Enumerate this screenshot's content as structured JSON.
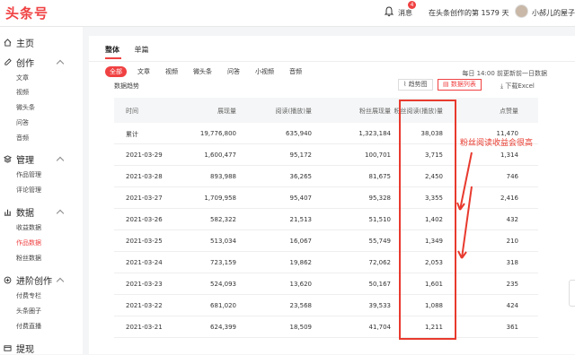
{
  "app": {
    "logo_text": "头条号",
    "messages_label": "消息",
    "messages_badge": "4",
    "days_text": "在头条创作的第 1579 天",
    "username": "小郝儿的屋子",
    "brand_color": "#f04142"
  },
  "sidebar": {
    "groups": [
      {
        "label": "主页",
        "icon": "home-icon",
        "items": []
      },
      {
        "label": "创作",
        "icon": "edit-icon",
        "items": [
          "文章",
          "视频",
          "微头条",
          "问答",
          "音频"
        ]
      },
      {
        "label": "管理",
        "icon": "layers-icon",
        "items": [
          "作品管理",
          "评论管理"
        ]
      },
      {
        "label": "数据",
        "icon": "chart-icon",
        "items": [
          "收益数据",
          "作品数据",
          "粉丝数据"
        ],
        "active_item": "作品数据"
      },
      {
        "label": "进阶创作",
        "icon": "advanced-icon",
        "items": [
          "付费专栏",
          "头条圈子",
          "付费直播"
        ]
      },
      {
        "label": "提现",
        "icon": "withdraw-icon",
        "items": []
      }
    ]
  },
  "panel": {
    "tabs": [
      "整体",
      "单篇"
    ],
    "active_tab": "整体",
    "chips": [
      "全部",
      "文章",
      "视频",
      "微头条",
      "问答",
      "小视频",
      "音频"
    ],
    "active_chip": "全部",
    "update_note": "每日 14:00 前更新前一日数据",
    "section_title": "数据趋势",
    "trend_button": "趋势图",
    "list_button": "数据列表",
    "excel_button": "下载Excel"
  },
  "table": {
    "headers": [
      "时间",
      "展现量",
      "阅读(播放)量",
      "粉丝展现量",
      "粉丝阅读(播放)量",
      "点赞量"
    ],
    "rows": [
      [
        "累计",
        "19,776,800",
        "635,940",
        "1,323,184",
        "38,038",
        "11,470"
      ],
      [
        "2021-03-29",
        "1,600,477",
        "95,172",
        "100,701",
        "3,715",
        "1,314"
      ],
      [
        "2021-03-28",
        "893,988",
        "36,265",
        "81,675",
        "2,450",
        "746"
      ],
      [
        "2021-03-27",
        "1,709,958",
        "95,407",
        "95,328",
        "3,355",
        "2,416"
      ],
      [
        "2021-03-26",
        "582,322",
        "21,513",
        "51,510",
        "1,402",
        "432"
      ],
      [
        "2021-03-25",
        "513,034",
        "16,067",
        "55,749",
        "1,349",
        "210"
      ],
      [
        "2021-03-24",
        "723,159",
        "19,862",
        "72,062",
        "2,053",
        "318"
      ],
      [
        "2021-03-23",
        "524,093",
        "13,620",
        "50,167",
        "1,601",
        "235"
      ],
      [
        "2021-03-22",
        "681,020",
        "23,568",
        "39,533",
        "1,088",
        "424"
      ],
      [
        "2021-03-21",
        "624,399",
        "18,509",
        "41,704",
        "1,211",
        "361"
      ]
    ]
  },
  "annotation": {
    "text": "粉丝阅读收益会很高",
    "color": "#e83a2e"
  }
}
